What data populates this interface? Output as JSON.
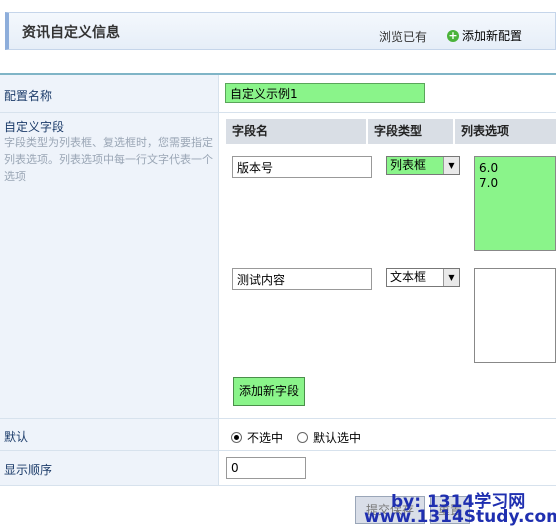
{
  "header": {
    "title": "资讯自定义信息",
    "browse_label": "浏览已有",
    "add_config_label": "添加新配置"
  },
  "form": {
    "name_label": "配置名称",
    "name_value": "自定义示例1",
    "custom_label": "自定义字段",
    "custom_hint": "字段类型为列表框、复选框时，您需要指定列表选项。列表选项中每一行文字代表一个选项",
    "columns": [
      "字段名",
      "字段类型",
      "列表选项"
    ],
    "fields": [
      {
        "name": "版本号",
        "type": "列表框",
        "options": "6.0\n7.0"
      },
      {
        "name": "测试内容",
        "type": "文本框",
        "options": ""
      }
    ],
    "add_field_label": "添加新字段",
    "default_label": "默认",
    "default_options": [
      "不选中",
      "默认选中"
    ],
    "default_selected": "不选中",
    "order_label": "显示顺序",
    "order_value": "0",
    "submit_label": "提交保存",
    "reset_label": "重置"
  },
  "watermark": {
    "line1": "by: 1314学习网",
    "line2": "www.1314Study.com"
  },
  "colors": {
    "highlight_green": "#8af48a",
    "label_bg": "#eef3fa",
    "label_text": "#1c3c6a",
    "watermark": "#1f2fb0"
  }
}
